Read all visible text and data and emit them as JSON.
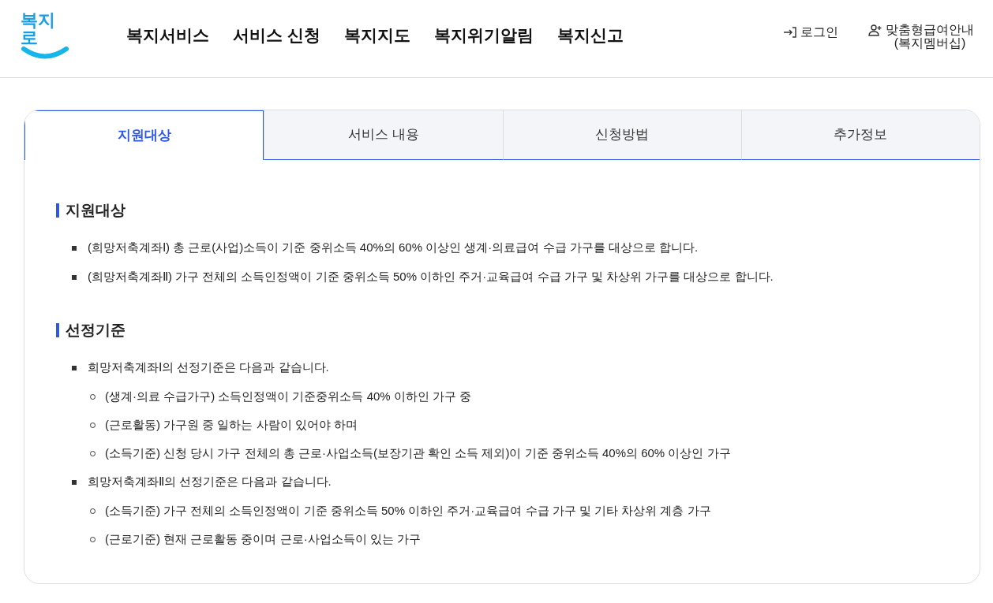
{
  "header": {
    "logo": "복지로",
    "nav": [
      "복지서비스",
      "서비스 신청",
      "복지지도",
      "복지위기알림",
      "복지신고"
    ],
    "login": "로그인",
    "membership": [
      "맞춤형급여안내",
      "(복지멤버십)"
    ]
  },
  "tabs": [
    {
      "label": "지원대상",
      "selected": true
    },
    {
      "label": "서비스 내용",
      "selected": false
    },
    {
      "label": "신청방법",
      "selected": false
    },
    {
      "label": "추가정보",
      "selected": false
    }
  ],
  "sections": [
    {
      "title": "지원대상",
      "items": [
        {
          "text": "(희망저축계좌Ⅰ) 총 근로(사업)소득이 기준 중위소득 40%의 60% 이상인 생계·의료급여 수급 가구를 대상으로 합니다."
        },
        {
          "text": "(희망저축계좌Ⅱ) 가구 전체의 소득인정액이 기준 중위소득 50% 이하인 주거·교육급여 수급 가구 및 차상위 가구를 대상으로 합니다."
        }
      ]
    },
    {
      "title": "선정기준",
      "items": [
        {
          "text": "희망저축계좌Ⅰ의 선정기준은 다음과 같습니다.",
          "children": [
            {
              "text": "(생계·의료 수급가구) 소득인정액이 기준중위소득 40% 이하인 가구 중"
            },
            {
              "text": "(근로활동) 가구원 중 일하는 사람이 있어야 하며"
            },
            {
              "text": "(소득기준) 신청 당시 가구 전체의 총 근로·사업소득(보장기관 확인 소득 제외)이 기준 중위소득 40%의 60% 이상인 가구"
            }
          ]
        },
        {
          "text": "희망저축계좌Ⅱ의 선정기준은 다음과 같습니다.",
          "children": [
            {
              "text": "(소득기준) 가구 전체의 소득인정액이 기준 중위소득 50% 이하인 주거·교육급여 수급 가구 및 기타 차상위 계층 가구"
            },
            {
              "text": "(근로기준) 현재 근로활동 중이며 근로·사업소득이 있는 가구"
            }
          ]
        }
      ]
    }
  ]
}
